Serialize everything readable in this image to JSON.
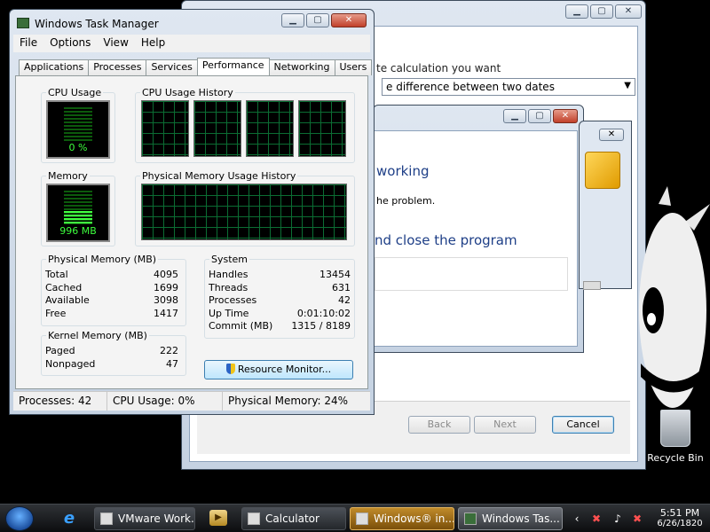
{
  "calc_window": {
    "heading": "te calculation you want",
    "dropdown_value": "e difference between two dates",
    "back_label": "Back",
    "next_label": "Next",
    "cancel_label": "Cancel"
  },
  "not_responding": {
    "title": "working",
    "subtitle": "he problem.",
    "option": "nd close the program"
  },
  "task_manager": {
    "title": "Windows Task Manager",
    "menu": [
      "File",
      "Options",
      "View",
      "Help"
    ],
    "tabs": [
      "Applications",
      "Processes",
      "Services",
      "Performance",
      "Networking",
      "Users"
    ],
    "active_tab": "Performance",
    "cpu_usage_label": "CPU Usage",
    "cpu_usage_value": "0 %",
    "cpu_history_label": "CPU Usage History",
    "memory_label": "Memory",
    "memory_value": "996 MB",
    "memory_fill_fraction": 0.24,
    "mem_history_label": "Physical Memory Usage History",
    "physical_memory": {
      "label": "Physical Memory (MB)",
      "rows": [
        {
          "k": "Total",
          "v": "4095"
        },
        {
          "k": "Cached",
          "v": "1699"
        },
        {
          "k": "Available",
          "v": "3098"
        },
        {
          "k": "Free",
          "v": "1417"
        }
      ]
    },
    "system": {
      "label": "System",
      "rows": [
        {
          "k": "Handles",
          "v": "13454"
        },
        {
          "k": "Threads",
          "v": "631"
        },
        {
          "k": "Processes",
          "v": "42"
        },
        {
          "k": "Up Time",
          "v": "0:01:10:02"
        },
        {
          "k": "Commit (MB)",
          "v": "1315 / 8189"
        }
      ]
    },
    "kernel_memory": {
      "label": "Kernel Memory (MB)",
      "rows": [
        {
          "k": "Paged",
          "v": "222"
        },
        {
          "k": "Nonpaged",
          "v": "47"
        }
      ]
    },
    "resource_monitor_label": "Resource Monitor...",
    "status": {
      "processes": "Processes: 42",
      "cpu": "CPU Usage: 0%",
      "memory": "Physical Memory: 24%"
    }
  },
  "desktop": {
    "recycle_bin_label": "Recycle Bin"
  },
  "taskbar": {
    "buttons": [
      "VMware Work...",
      "Calculator",
      "Windows® in...",
      "Windows Tas..."
    ],
    "time": "5:51 PM",
    "date": "6/26/1820"
  }
}
